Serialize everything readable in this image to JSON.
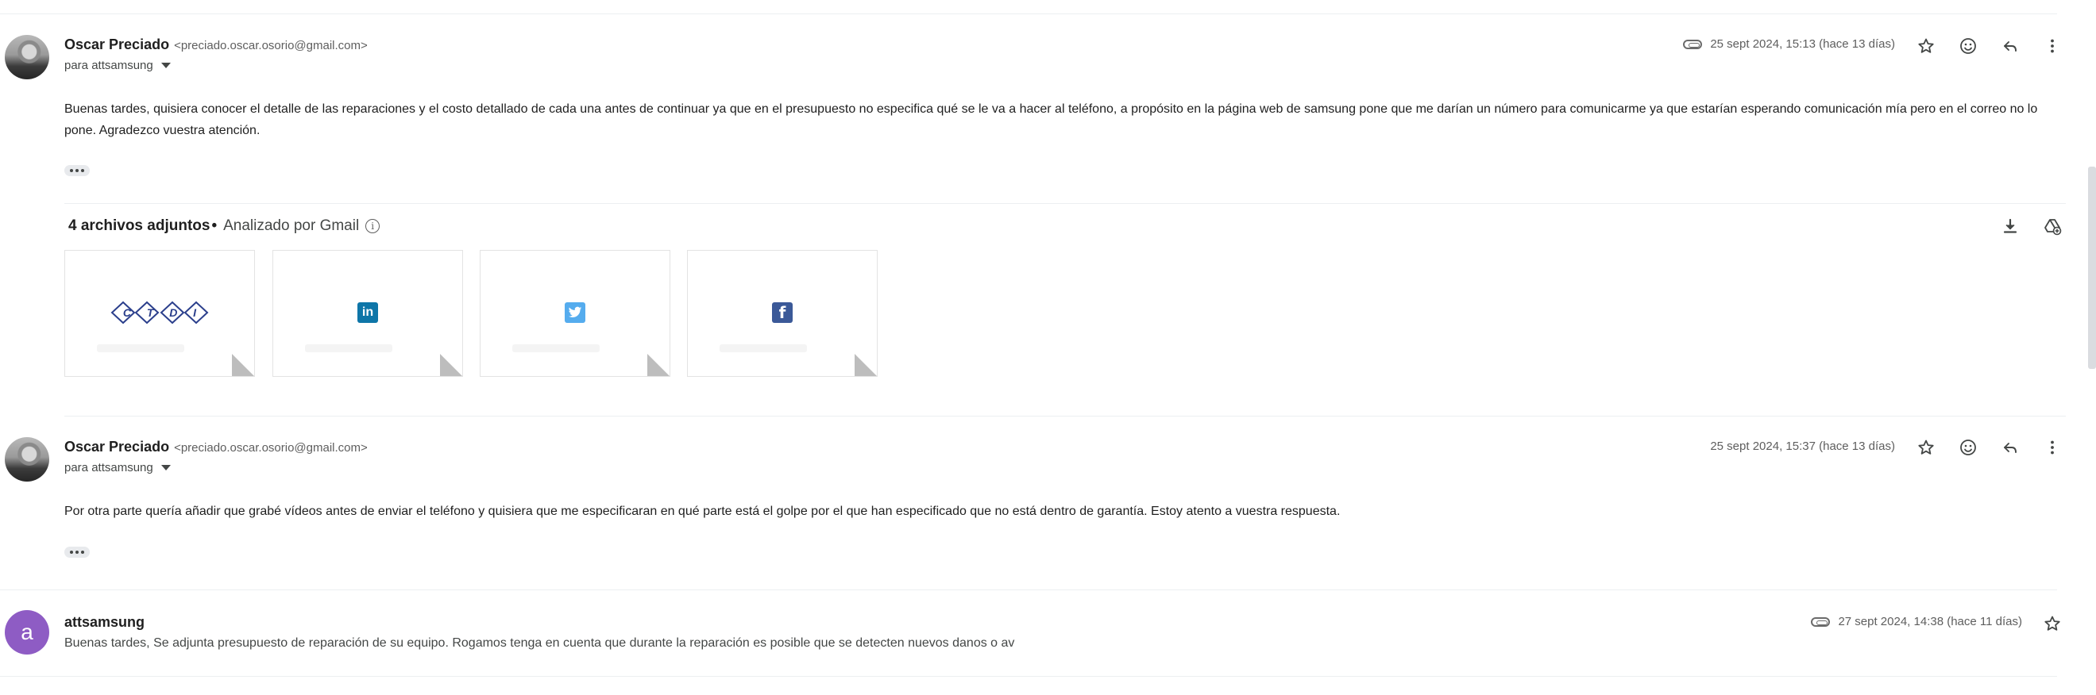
{
  "messages": [
    {
      "sender_name": "Oscar Preciado",
      "sender_email": "<preciado.oscar.osorio@gmail.com>",
      "recipient": "para attsamsung",
      "date": "25 sept 2024, 15:13 (hace 13 días)",
      "has_attachment_icon": true,
      "body": "Buenas tardes, quisiera conocer el detalle de las reparaciones y el costo detallado de cada una antes de continuar ya que en el presupuesto no especifica qué se le va a hacer al teléfono, a propósito en la página web de samsung pone que me darían un número para comunicarme ya que estarían esperando comunicación mía pero en el correo no lo pone. Agradezco vuestra atención."
    },
    {
      "sender_name": "Oscar Preciado",
      "sender_email": "<preciado.oscar.osorio@gmail.com>",
      "recipient": "para attsamsung",
      "date": "25 sept 2024, 15:37 (hace 13 días)",
      "has_attachment_icon": false,
      "body": "Por otra parte quería añadir que grabé vídeos antes de enviar el teléfono y quisiera que me especificaran en qué parte está el golpe por el que han especificado que no está dentro de garantía. Estoy atento a vuestra respuesta."
    },
    {
      "sender_name": "attsamsung",
      "avatar_letter": "a",
      "date": "27 sept 2024, 14:38 (hace 11 días)",
      "has_attachment_icon": true,
      "snippet": "Buenas tardes, Se adjunta presupuesto de reparación de su equipo. Rogamos tenga en cuenta que durante la reparación es posible que se detecten nuevos danos o av"
    }
  ],
  "attachments": {
    "count_label": "4 archivos adjuntos",
    "separator": "•",
    "scanned_label": "Analizado por Gmail",
    "items": [
      {
        "icon": "ctdi-logo",
        "logo_text": [
          "C",
          "T",
          "D",
          "I"
        ]
      },
      {
        "icon": "linkedin-icon",
        "logo_text": "in",
        "color": "#0e76a8"
      },
      {
        "icon": "twitter-icon",
        "logo_text": "",
        "color": "#55acee"
      },
      {
        "icon": "facebook-icon",
        "logo_text": "f",
        "color": "#3b5998"
      }
    ]
  },
  "colors": {
    "avatar_purple": "#8e5cc4",
    "divider": "#eceff1",
    "secondary_text": "#5e5e5e"
  }
}
